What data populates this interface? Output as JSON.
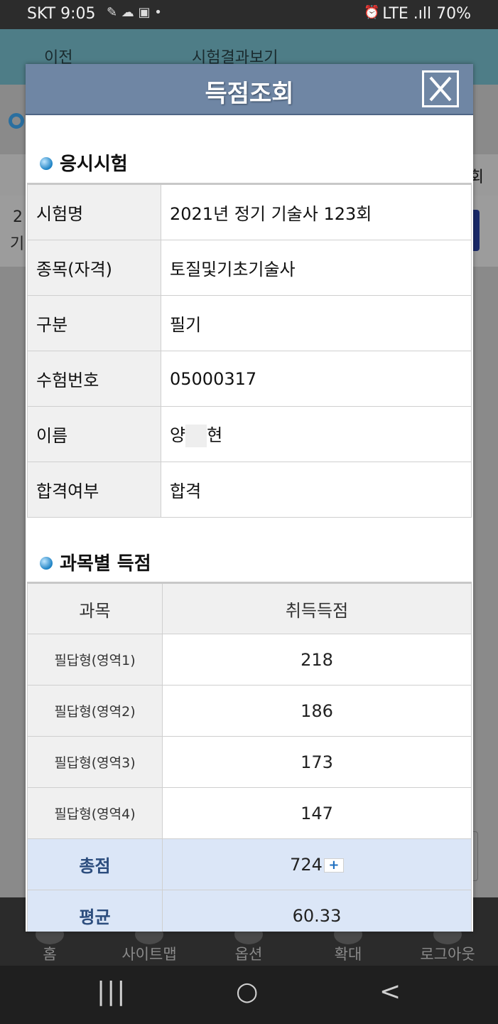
{
  "status_bar": {
    "carrier_time": "SKT 9:05",
    "battery": "LTE .ıll 70%"
  },
  "background_page": {
    "prev_label": "이전",
    "title": "시험결과보기",
    "header_col": "회",
    "row_line1": "2",
    "row_line2": "기"
  },
  "modal": {
    "title": "득점조회",
    "section_exam": "응시시험",
    "exam_rows": [
      {
        "label": "시험명",
        "value": "2021년 정기 기술사 123회"
      },
      {
        "label": "종목(자격)",
        "value": "토질및기초기술사"
      },
      {
        "label": "구분",
        "value": "필기"
      },
      {
        "label": "수험번호",
        "value": "05000317"
      },
      {
        "label": "이름",
        "value_first": "양",
        "value_last": "현"
      },
      {
        "label": "합격여부",
        "value": "합격"
      }
    ],
    "section_scores": "과목별 득점",
    "score_headers": {
      "subject": "과목",
      "score": "취득득점"
    },
    "score_rows": [
      {
        "subject": "필답형(영역1)",
        "score": "218"
      },
      {
        "subject": "필답형(영역2)",
        "score": "186"
      },
      {
        "subject": "필답형(영역3)",
        "score": "173"
      },
      {
        "subject": "필답형(영역4)",
        "score": "147"
      }
    ],
    "total": {
      "label": "총점",
      "value": "724",
      "plus": "+"
    },
    "average": {
      "label": "평균",
      "value": "60.33"
    }
  },
  "app_nav": {
    "home": "홈",
    "sitemap": "사이트맵",
    "options": "옵션",
    "zoom": "확대",
    "logout": "로그아웃"
  },
  "system_nav": {
    "recents": "|||",
    "home": "○",
    "back": "<"
  }
}
